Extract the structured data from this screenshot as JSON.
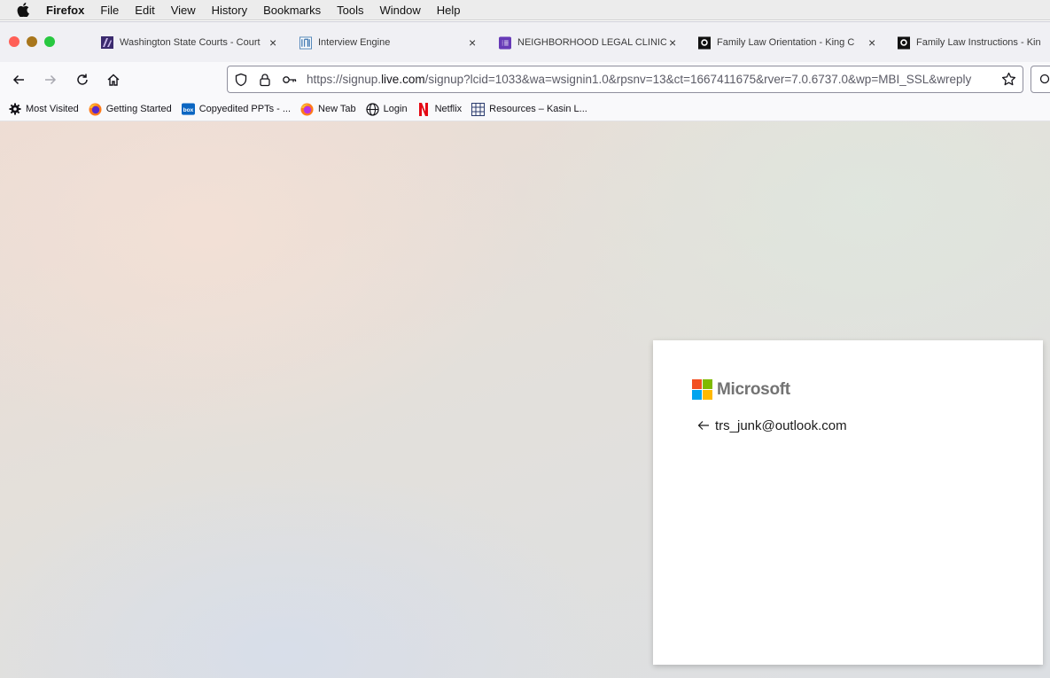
{
  "menubar": {
    "app_name": "Firefox",
    "items": [
      "File",
      "Edit",
      "View",
      "History",
      "Bookmarks",
      "Tools",
      "Window",
      "Help"
    ]
  },
  "tabs": [
    {
      "title": "Washington State Courts - Court",
      "icon": "wa-courts-icon"
    },
    {
      "title": "Interview Engine",
      "icon": "interview-engine-icon"
    },
    {
      "title": "NEIGHBORHOOD LEGAL CLINIC",
      "icon": "form-icon"
    },
    {
      "title": "Family Law Orientation - King C",
      "icon": "king-county-icon"
    },
    {
      "title": "Family Law Instructions - Kin",
      "icon": "king-county-icon"
    }
  ],
  "address_bar": {
    "url_prefix": "https://signup.",
    "url_host": "live.com",
    "url_rest": "/signup?lcid=1033&wa=wsignin1.0&rpsnv=13&ct=1667411675&rver=7.0.6737.0&wp=MBI_SSL&wreply"
  },
  "bookmarks": [
    {
      "label": "Most Visited",
      "icon": "gear-icon"
    },
    {
      "label": "Getting Started",
      "icon": "firefox-icon"
    },
    {
      "label": "Copyedited PPTs - ...",
      "icon": "box-icon"
    },
    {
      "label": "New Tab",
      "icon": "firefox-icon"
    },
    {
      "label": "Login",
      "icon": "globe-icon"
    },
    {
      "label": "Netflix",
      "icon": "netflix-icon"
    },
    {
      "label": "Resources – Kasin L...",
      "icon": "grid-icon"
    }
  ],
  "signin_card": {
    "brand": "Microsoft",
    "account_email": "trs_junk@outlook.com"
  },
  "colors": {
    "ms_red": "#f25022",
    "ms_green": "#7fba00",
    "ms_blue": "#00a4ef",
    "ms_yellow": "#ffb900",
    "close": "#ff5f57",
    "minimize": "#a8761c",
    "zoom": "#28c840"
  }
}
